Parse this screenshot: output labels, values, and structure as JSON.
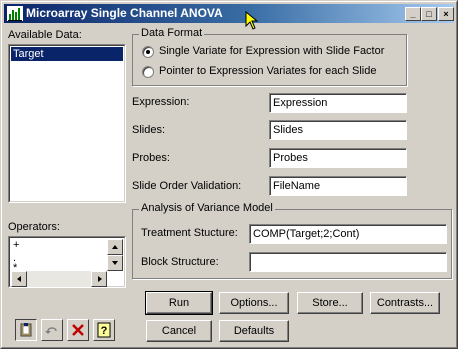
{
  "window": {
    "title": "Microarray Single Channel ANOVA",
    "minimize": "_",
    "maximize": "□",
    "close": "×"
  },
  "available_data": {
    "label": "Available Data:",
    "items": [
      "Target"
    ]
  },
  "operators": {
    "label": "Operators:",
    "items": [
      "+",
      ".",
      "*"
    ]
  },
  "data_format": {
    "title": "Data Format",
    "option1": "Single Variate for Expression with Slide Factor",
    "option2": "Pointer to Expression Variates for each Slide",
    "selected": 1
  },
  "fields": {
    "expression_label": "Expression:",
    "expression_value": "Expression",
    "slides_label": "Slides:",
    "slides_value": "Slides",
    "probes_label": "Probes:",
    "probes_value": "Probes",
    "slide_order_label": "Slide Order Validation:",
    "slide_order_value": "FileName"
  },
  "anova_model": {
    "title": "Analysis of Variance Model",
    "treatment_label": "Treatment Stucture:",
    "treatment_value": "COMP(Target;2;Cont)",
    "block_label": "Block Structure:",
    "block_value": ""
  },
  "buttons": {
    "run": "Run",
    "options": "Options...",
    "store": "Store...",
    "contrasts": "Contrasts...",
    "cancel": "Cancel",
    "defaults": "Defaults"
  },
  "tool_icons": [
    "clipboard-icon",
    "undo-icon",
    "clear-icon",
    "help-icon"
  ],
  "colors": {
    "title_gradient_start": "#0a246a",
    "title_gradient_end": "#a6caf0",
    "selection": "#0a246a",
    "clear_red": "#c00000"
  }
}
